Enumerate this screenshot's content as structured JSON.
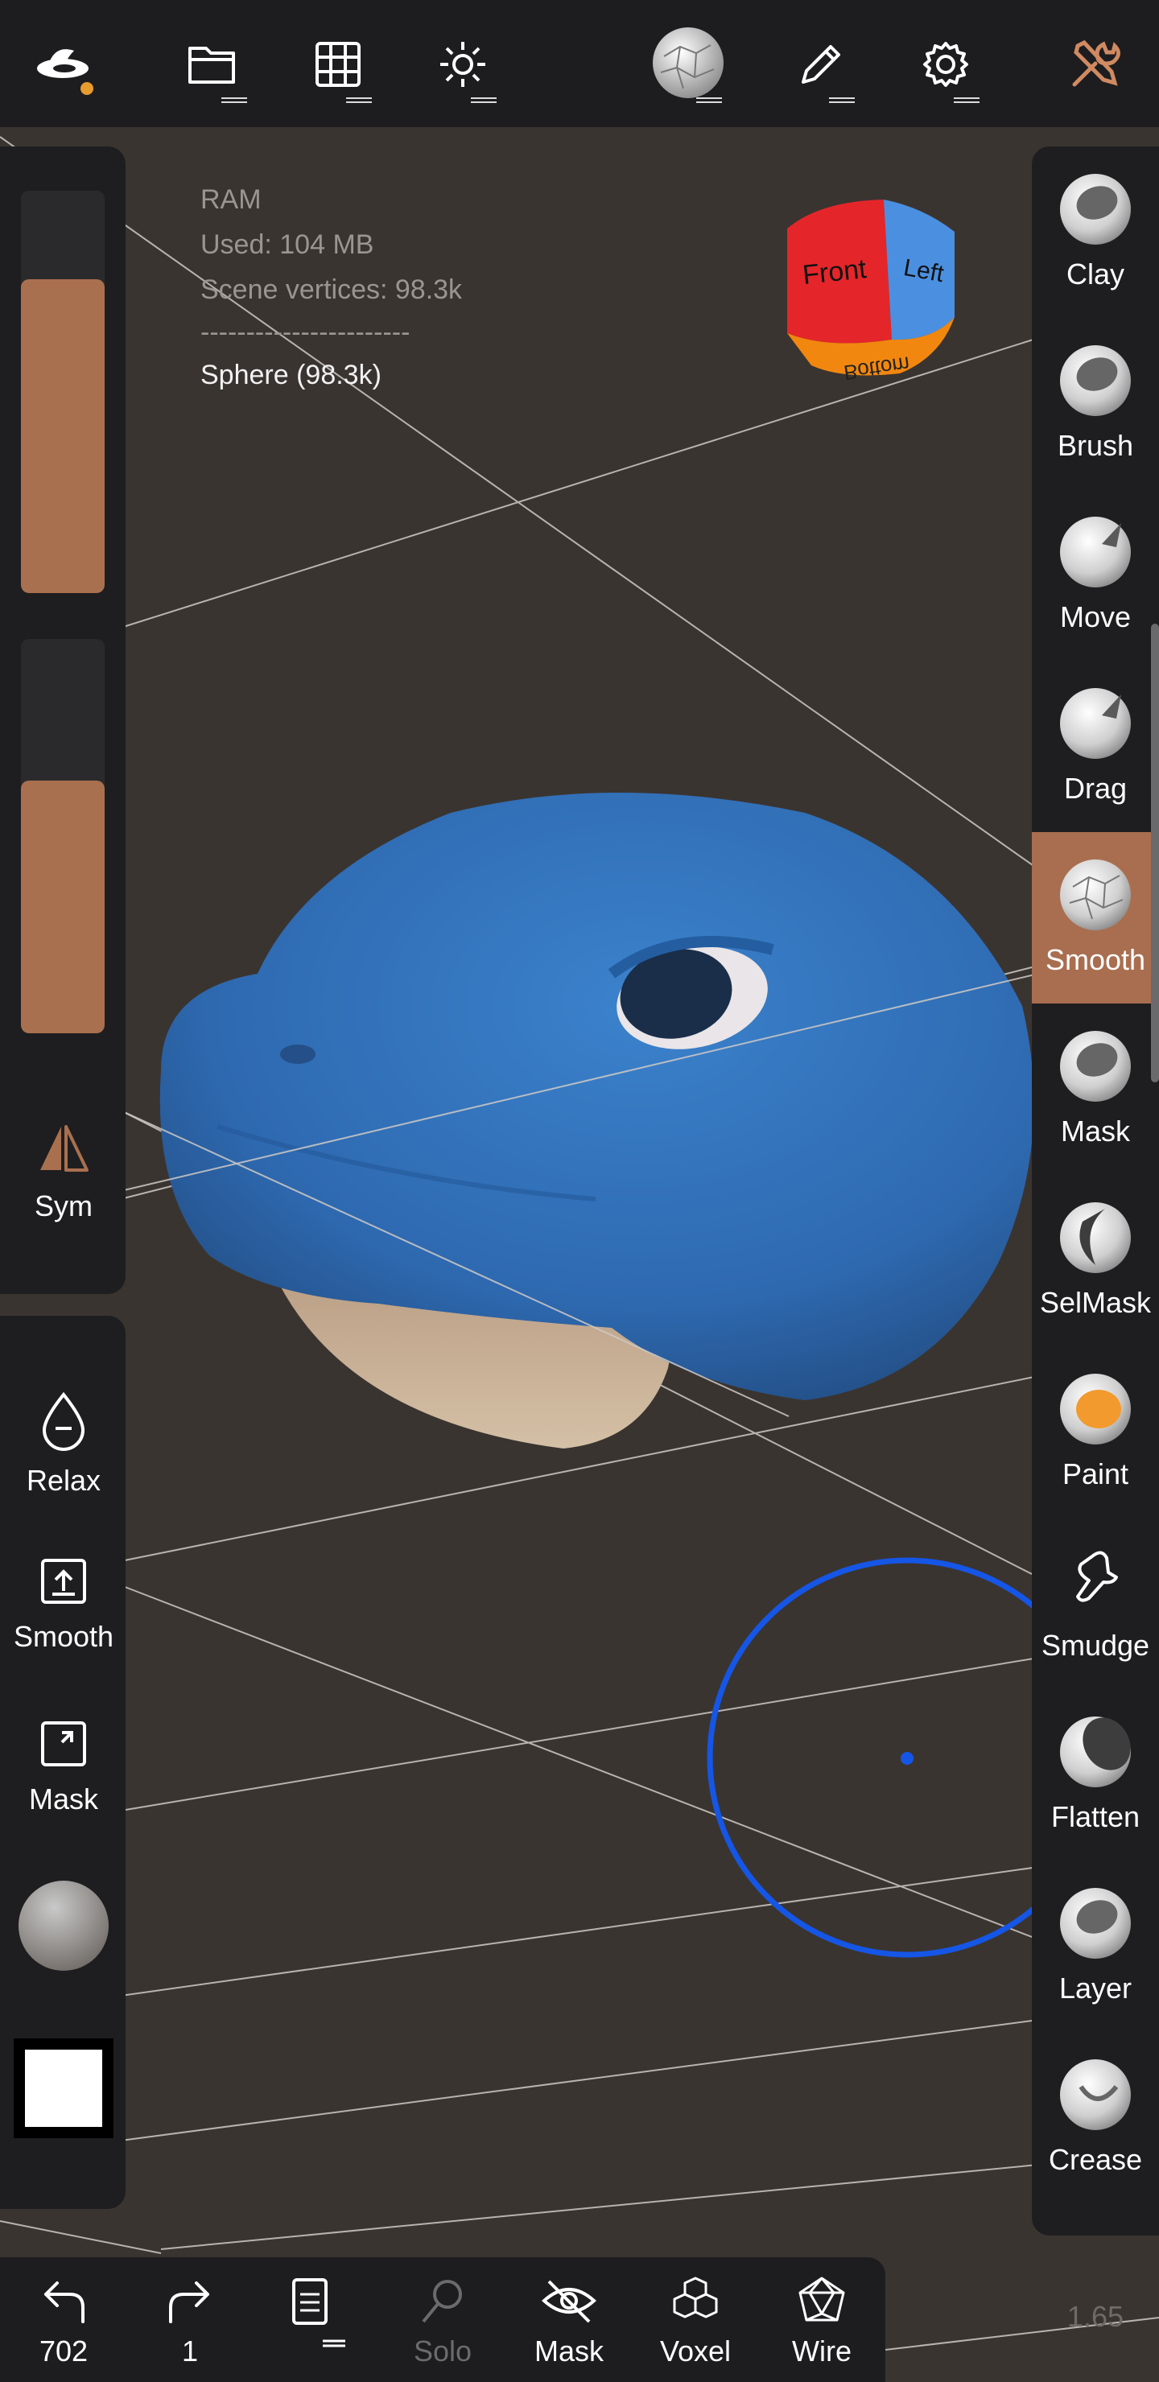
{
  "info": {
    "ram": "RAM",
    "used": "Used: 104 MB",
    "vertices": "Scene vertices: 98.3k",
    "separator": "-----------------------",
    "object": "Sphere (98.3k)"
  },
  "cube": {
    "front": "Front",
    "left": "Left",
    "bottom": "Bottom"
  },
  "left_panel": {
    "sym_label": "Sym",
    "radius_level": 0.78,
    "intensity_level": 0.64,
    "buttons": [
      {
        "label": "Relax",
        "icon": "drop-icon"
      },
      {
        "label": "Smooth",
        "icon": "upload-box-icon"
      },
      {
        "label": "Mask",
        "icon": "expand-box-icon"
      }
    ]
  },
  "tools": [
    {
      "label": "Clay",
      "icon": "clay-icon"
    },
    {
      "label": "Brush",
      "icon": "brush-icon"
    },
    {
      "label": "Move",
      "icon": "move-icon"
    },
    {
      "label": "Drag",
      "icon": "drag-icon"
    },
    {
      "label": "Smooth",
      "icon": "smooth-icon",
      "active": true
    },
    {
      "label": "Mask",
      "icon": "mask-icon"
    },
    {
      "label": "SelMask",
      "icon": "selmask-icon"
    },
    {
      "label": "Paint",
      "icon": "paint-icon"
    },
    {
      "label": "Smudge",
      "icon": "smudge-icon"
    },
    {
      "label": "Flatten",
      "icon": "flatten-icon"
    },
    {
      "label": "Layer",
      "icon": "layer-icon"
    },
    {
      "label": "Crease",
      "icon": "crease-icon"
    }
  ],
  "bottom": {
    "undo_count": "702",
    "redo_count": "1",
    "solo": "Solo",
    "mask": "Mask",
    "voxel": "Voxel",
    "wire": "Wire"
  },
  "version": "1.65",
  "colors": {
    "accent": "#a9704f",
    "model": "#2f6fbd",
    "brush_ring": "#1556e6"
  }
}
